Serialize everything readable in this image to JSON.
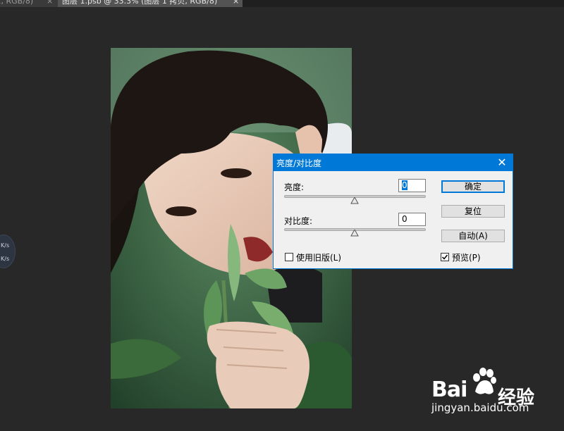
{
  "tabs": [
    {
      "label": "., RGB/8)",
      "close": "×"
    },
    {
      "label": "图层 1.psb @ 33.3% (图层 1 拷贝, RGB/8)",
      "close": "×"
    }
  ],
  "net_widget": {
    "line1": "K/s",
    "line2": "K/s"
  },
  "dialog": {
    "title": "亮度/对比度",
    "close": "✕",
    "brightness_label": "亮度:",
    "brightness_value": "0",
    "contrast_label": "对比度:",
    "contrast_value": "0",
    "ok": "确定",
    "reset": "复位",
    "auto": "自动(A)",
    "legacy_label": "使用旧版(L)",
    "legacy_checked": false,
    "preview_label": "预览(P)",
    "preview_checked": true
  },
  "watermark": {
    "brand": "Bai",
    "brand_cn": "经验",
    "url": "jingyan.baidu.com"
  }
}
